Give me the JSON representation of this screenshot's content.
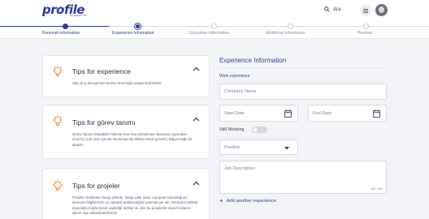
{
  "brand": {
    "logo": "profile",
    "tagline": "by kariyer.net"
  },
  "header": {
    "search_label": "Ara"
  },
  "steps": [
    {
      "label": "Personal Information",
      "state": "done"
    },
    {
      "label": "Experience Information",
      "state": "active"
    },
    {
      "label": "Education Information",
      "state": "todo"
    },
    {
      "label": "Additional Information",
      "state": "todo"
    },
    {
      "label": "Preview",
      "state": "todo"
    }
  ],
  "tips": [
    {
      "title": "Tips for experience",
      "text": "Staj ve iş deneyimleri tersine kronolojik sırayla iletilmelidir."
    },
    {
      "title": "Tips for görev tanımı",
      "text": "Görev Tanımı (Maddeler halinde kısa kısa anlatılması okunması açısından önemli.) Çok uzun yazılar okunmasında dikkat etmek gerekir.) bilgiye bağlı bir alandır."
    },
    {
      "title": "Tips for projeler",
      "text": "Projeleri belirtirken hangi şirkette, hangi yıllar arası o projede bulunduğunu deneyim bilgilerinizle eş zamanlı arabileceğiniz yanında yer alır. Deneyim bölümü dışındaki projelerinizde yapıldığı tarihler ve yine bu projelerde veya freelance işlerin diye adlandırabilirsiniz."
    }
  ],
  "form": {
    "section_title": "Experience Information",
    "subsection_title": "Work experience",
    "company_placeholder": "Company Name",
    "start_date_placeholder": "Start Date",
    "end_date_placeholder": "End Date",
    "still_working_label": "Still Working",
    "still_working": false,
    "position_placeholder": "Position",
    "job_description_placeholder": "Job Description",
    "char_counter": "300 / 300",
    "add_another_label": "Add another experience"
  },
  "colors": {
    "brand": "#2d3a9a",
    "accent": "#f08a3c",
    "inactive": "#c9ccd6"
  },
  "icons": [
    "search-icon",
    "menu-icon",
    "avatar",
    "lightbulb-icon",
    "chevron-up-icon",
    "calendar-icon",
    "chevron-down-icon",
    "plus-icon"
  ]
}
